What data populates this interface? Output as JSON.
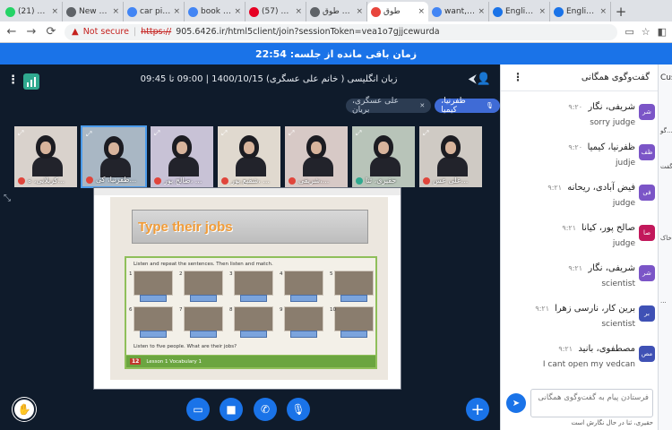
{
  "browser": {
    "tabs": [
      {
        "title": "(21) Wha",
        "favicon": "whatsapp",
        "color": "#25d366"
      },
      {
        "title": "New Doc",
        "favicon": "globe",
        "color": "#5f6368"
      },
      {
        "title": "car pinte",
        "favicon": "google",
        "color": "#4285f4"
      },
      {
        "title": "book pin",
        "favicon": "google",
        "color": "#4285f4"
      },
      {
        "title": "(57) Pint",
        "favicon": "pinterest",
        "color": "#e60023"
      },
      {
        "title": "پرتال طوق",
        "favicon": "globe",
        "color": "#5f6368"
      },
      {
        "title": "طوق",
        "favicon": "bbb",
        "color": "#e8453c",
        "active": true
      },
      {
        "title": "want, do",
        "favicon": "google",
        "color": "#4285f4"
      },
      {
        "title": "English w",
        "favicon": "translate",
        "color": "#1a73e8"
      },
      {
        "title": "English w",
        "favicon": "translate",
        "color": "#1a73e8"
      }
    ],
    "not_secure": "Not secure",
    "url_scheme": "https://",
    "url_rest": "905.6426.ir/html5client/join?sessionToken=vea1o7gjjcewurda"
  },
  "banner": {
    "text": "زمان باقی مانده از جلسه: 22:54"
  },
  "meeting": {
    "title": "زبان انگلیسی ( خانم علی عسگری) 1400/10/15 | 09:00 تا 09:45",
    "presenters": [
      {
        "name": "علی عسگری، بریان",
        "state": "muted"
      },
      {
        "name": "ظفرنیا، کیمیا",
        "state": "talking"
      }
    ],
    "videos": [
      {
        "name": "کربلایی، ه...",
        "mic": "off"
      },
      {
        "name": "ظفرنیا، کی...",
        "mic": "off",
        "active": true
      },
      {
        "name": "صالح پور، ...",
        "mic": "off"
      },
      {
        "name": "شفیع پور، ...",
        "mic": "off"
      },
      {
        "name": "شریفی،...",
        "mic": "off"
      },
      {
        "name": "حقیری، ثنا",
        "mic": "on"
      },
      {
        "name": "علی عس...",
        "mic": "off"
      }
    ],
    "slide": {
      "heading": "Type their jobs",
      "instruction1": "Listen and repeat the sentences. Then listen and match.",
      "instruction2": "Listen to five people. What are their jobs?",
      "page_number": "12",
      "footer": "Lesson 1 Vocabulary 1"
    },
    "controls": [
      "raise-hand",
      "share-screen",
      "video",
      "phone",
      "mic",
      "plus"
    ]
  },
  "chat": {
    "title": "گفت‌وگوی همگانی",
    "messages": [
      {
        "name": "شریفی، نگار",
        "time": "۹:۲۰",
        "text": "sorry judge",
        "avatar": "شر",
        "color": "#7b55c7"
      },
      {
        "name": "ظفرنیا، کیمیا",
        "time": "۹:۲۰",
        "text": "judje",
        "avatar": "ظف",
        "color": "#7b55c7"
      },
      {
        "name": "فیض آبادی، ریحانه",
        "time": "۹:۲۱",
        "text": "judge",
        "avatar": "فی",
        "color": "#7b55c7"
      },
      {
        "name": "صالح پور، کیانا",
        "time": "۹:۲۱",
        "text": "judge",
        "avatar": "صا",
        "color": "#c2185b"
      },
      {
        "name": "شریفی، نگار",
        "time": "۹:۲۱",
        "text": "scientist",
        "avatar": "شر",
        "color": "#7b55c7"
      },
      {
        "name": "برین کار، نارسی زهرا",
        "time": "۹:۲۱",
        "text": "scientist",
        "avatar": "بر",
        "color": "#3f51b5"
      },
      {
        "name": "مصطفوی، بانید",
        "time": "۹:۲۱",
        "text": "I cant open my vedcan",
        "avatar": "مص",
        "color": "#3f51b5"
      }
    ],
    "input_placeholder": "فرستادن پیام به گفت‌وگوی همگانی",
    "typing": "حقیری، ثنا در حال نگارش است"
  },
  "far_panel": {
    "title": "Custom bra",
    "items": [
      "گو...",
      "گفت...",
      "خاک...",
      "..."
    ]
  }
}
